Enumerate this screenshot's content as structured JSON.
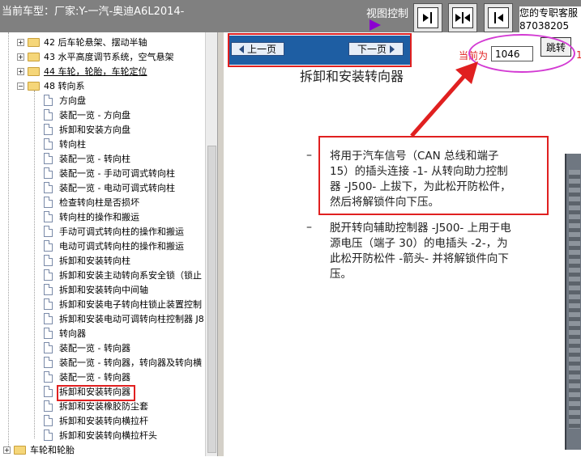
{
  "topbar": {
    "model": "当前车型：厂家:Y-一汽-奥迪A6L2014-",
    "view_control": "视图控制",
    "support_line1": "您的专职客服",
    "support_line2": "87038205"
  },
  "tree": {
    "items": [
      {
        "label": "42 后车轮悬架、摆动半轴",
        "kind": "folder"
      },
      {
        "label": "43 水平高度调节系统，空气悬架",
        "kind": "folder"
      },
      {
        "label": "44 车轮，轮胎，车轮定位",
        "kind": "folder"
      },
      {
        "label": "48 转向系",
        "kind": "folder-open"
      },
      {
        "label": "方向盘",
        "kind": "doc"
      },
      {
        "label": "装配一览 - 方向盘",
        "kind": "doc"
      },
      {
        "label": "拆卸和安装方向盘",
        "kind": "doc"
      },
      {
        "label": "转向柱",
        "kind": "doc"
      },
      {
        "label": "装配一览 - 转向柱",
        "kind": "doc"
      },
      {
        "label": "装配一览 - 手动可调式转向柱",
        "kind": "doc"
      },
      {
        "label": "装配一览 - 电动可调式转向柱",
        "kind": "doc"
      },
      {
        "label": "检查转向柱是否损坏",
        "kind": "doc"
      },
      {
        "label": "转向柱的操作和搬运",
        "kind": "doc"
      },
      {
        "label": "手动可调式转向柱的操作和搬运",
        "kind": "doc"
      },
      {
        "label": "电动可调式转向柱的操作和搬运",
        "kind": "doc"
      },
      {
        "label": "拆卸和安装转向柱",
        "kind": "doc"
      },
      {
        "label": "拆卸和安装主动转向系安全锁（锁止",
        "kind": "doc"
      },
      {
        "label": "拆卸和安装转向中间轴",
        "kind": "doc"
      },
      {
        "label": "拆卸和安装电子转向柱锁止装置控制",
        "kind": "doc"
      },
      {
        "label": "拆卸和安装电动可调转向柱控制器 J8",
        "kind": "doc"
      },
      {
        "label": "转向器",
        "kind": "doc"
      },
      {
        "label": "装配一览 - 转向器",
        "kind": "doc"
      },
      {
        "label": "装配一览 - 转向器，转向器及转向横",
        "kind": "doc"
      },
      {
        "label": "装配一览 - 转向器",
        "kind": "doc"
      },
      {
        "label": "拆卸和安装转向器",
        "kind": "doc"
      },
      {
        "label": "拆卸和安装橡胶防尘套",
        "kind": "doc"
      },
      {
        "label": "拆卸和安装转向横拉杆",
        "kind": "doc"
      },
      {
        "label": "拆卸和安装转向横拉杆头",
        "kind": "doc"
      },
      {
        "label": "车轮和轮胎",
        "kind": "folder"
      }
    ]
  },
  "nav": {
    "prev_label": "上一页",
    "next_label": "下一页",
    "current_label": "当前为",
    "page_value": "1046",
    "jump_label": "跳转",
    "stray": "1"
  },
  "doc": {
    "title": "拆卸和安装转向器",
    "bullet1_line1": "将用于汽车信号（CAN 总线和端子",
    "bullet1_line2": "15）的插头连接 -1- 从转向助力控制",
    "bullet1_line3": "器 -J500- 上拔下，为此松开防松件，",
    "bullet1_line4": "然后将解锁件向下压。",
    "bullet2_line1": "脱开转向辅助控制器 -J500- 上用于电",
    "bullet2_line2": "源电压（端子 30）的电插头 -2-，为",
    "bullet2_line3": "此松开防松件 -箭头- 并将解锁件向下",
    "bullet2_line4": "压。",
    "bullet_mark": "–"
  },
  "colors": {
    "topbar": "#808080",
    "nav_bar": "#1e5ea3",
    "highlight_red": "#e02020",
    "oval_magenta": "#d33ad3"
  }
}
